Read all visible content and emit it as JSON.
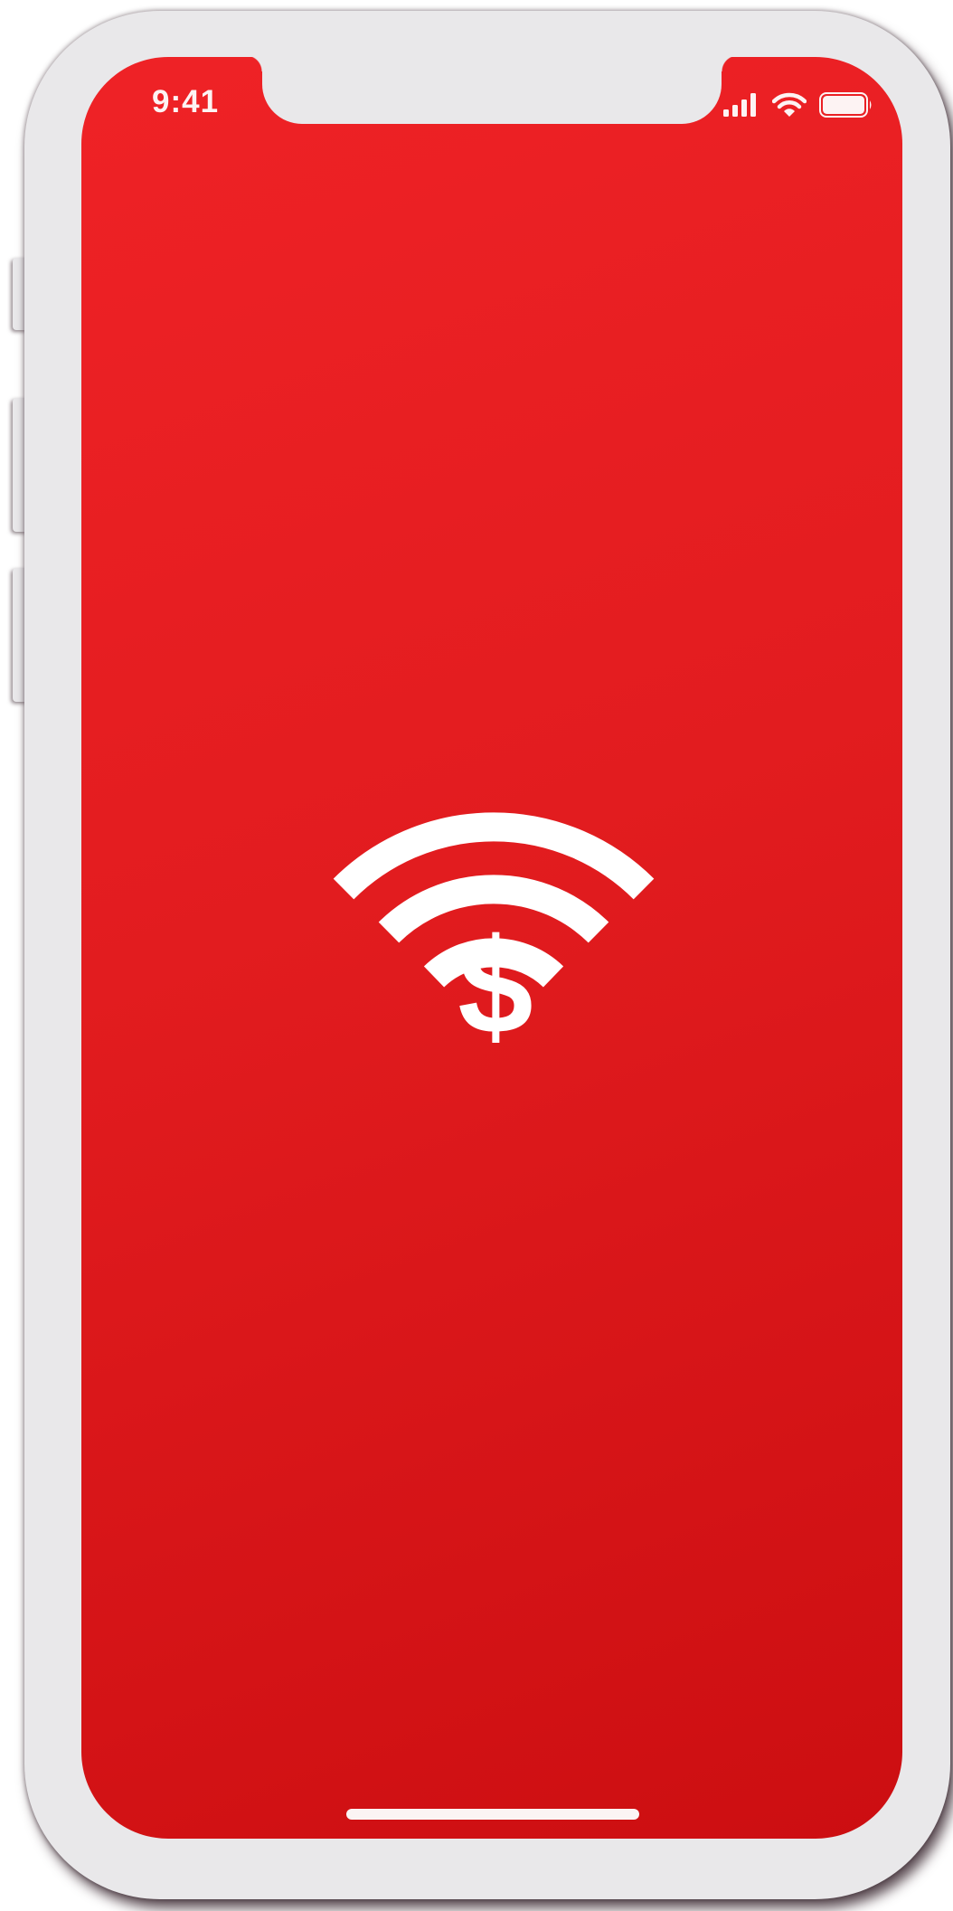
{
  "status_bar": {
    "time": "9:41",
    "icons": [
      "cellular-signal-icon",
      "wifi-icon",
      "battery-icon"
    ]
  },
  "main": {
    "symbol": {
      "icon": "contactless-payment-icon",
      "glyph": "$"
    }
  },
  "colors": {
    "screen_gradient_start": "#ef2226",
    "screen_gradient_end": "#cc0e11",
    "foreground": "#ffffff",
    "phone_body": "#e9e8ea"
  }
}
